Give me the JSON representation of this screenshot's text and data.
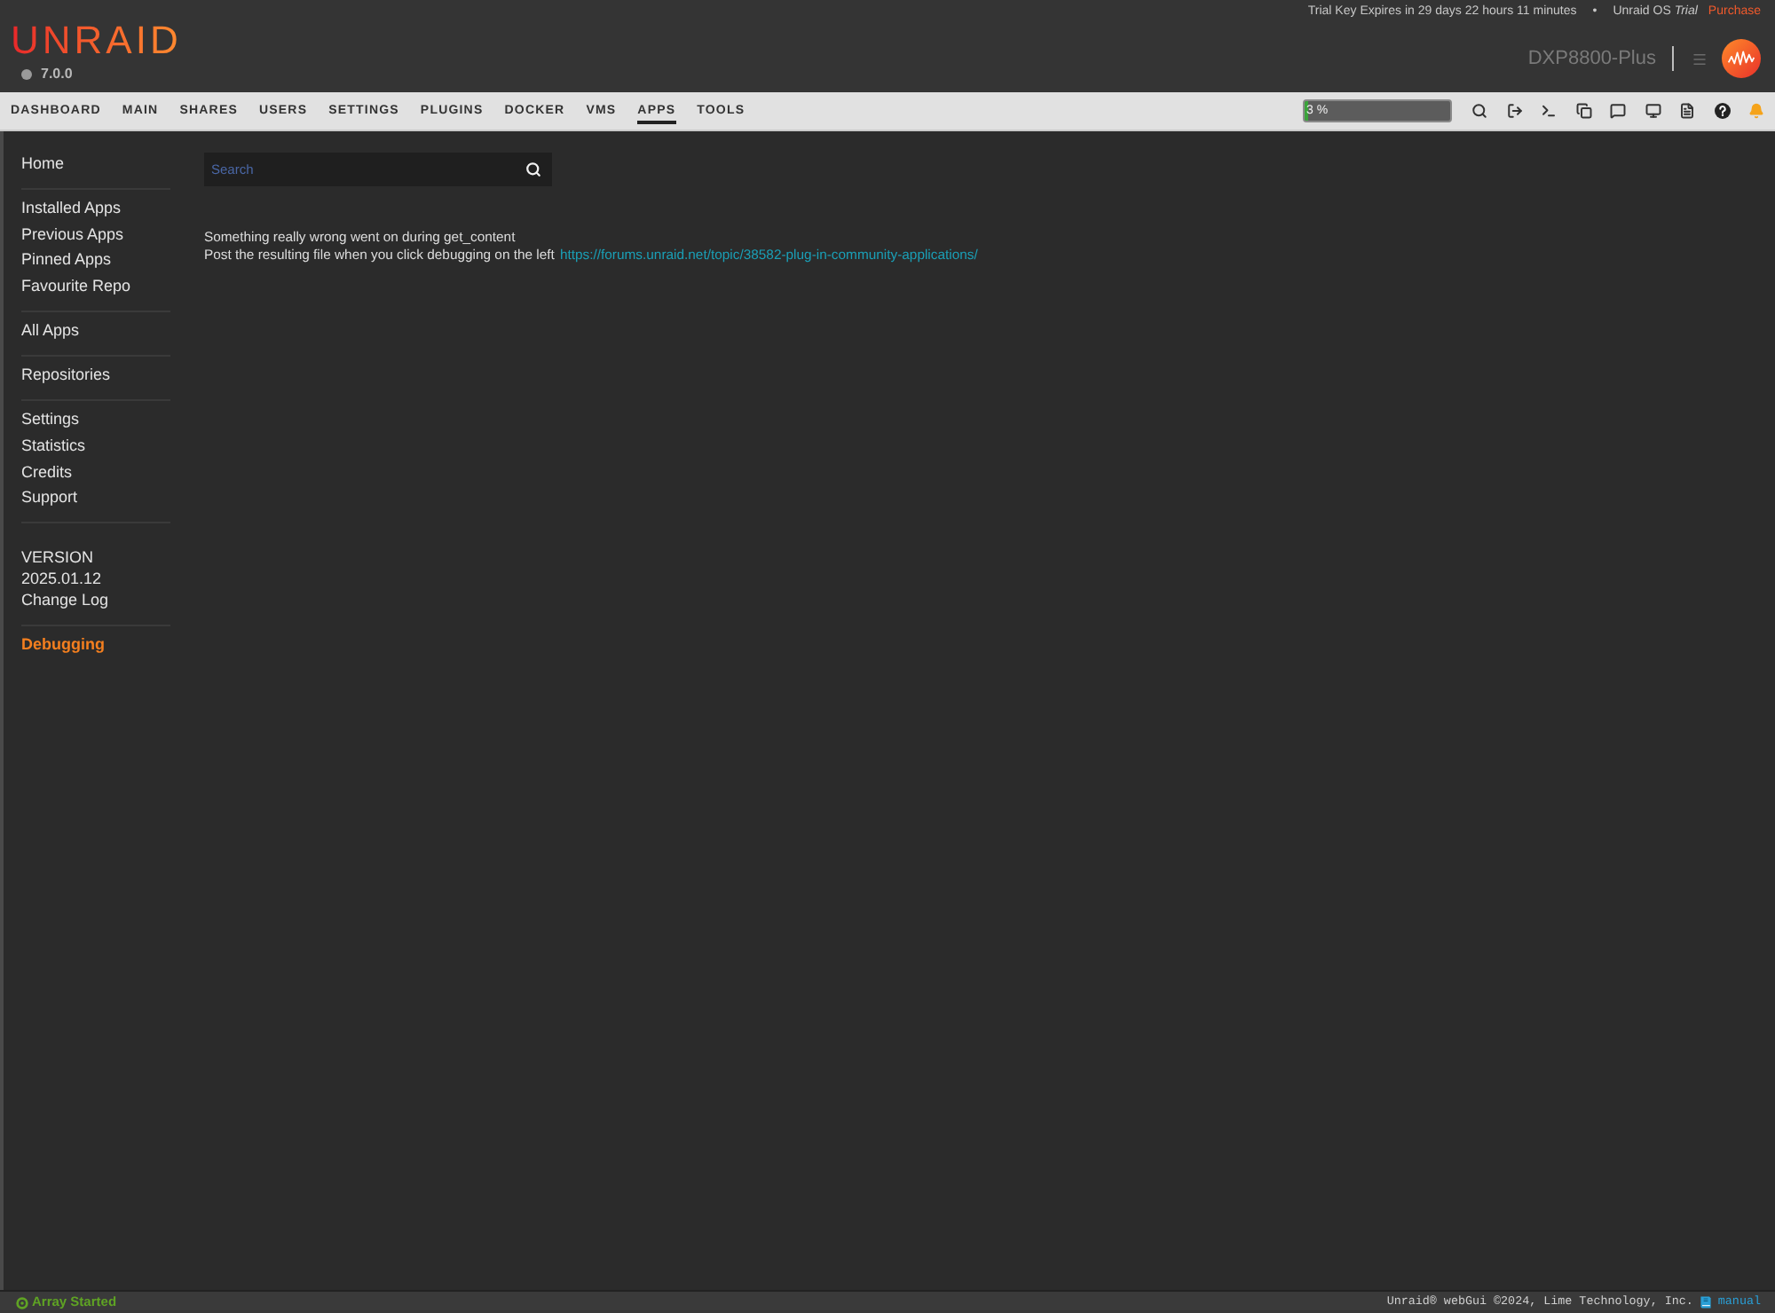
{
  "header": {
    "logo": "UNRAID",
    "version": "7.0.0",
    "trial_notice": {
      "expiry": "Trial Key Expires in 29 days 22 hours 11 minutes",
      "separator": "•",
      "license": "Unraid OS *Trial*",
      "purchase_link": "Purchase"
    },
    "server_name": "DXP8800-Plus"
  },
  "nav": {
    "tabs": [
      {
        "label": "DASHBOARD",
        "selected": false
      },
      {
        "label": "MAIN",
        "selected": false
      },
      {
        "label": "SHARES",
        "selected": false
      },
      {
        "label": "USERS",
        "selected": false
      },
      {
        "label": "SETTINGS",
        "selected": false
      },
      {
        "label": "PLUGINS",
        "selected": false
      },
      {
        "label": "DOCKER",
        "selected": false
      },
      {
        "label": "VMS",
        "selected": false
      },
      {
        "label": "APPS",
        "selected": true
      },
      {
        "label": "TOOLS",
        "selected": false
      }
    ],
    "cpu_meter": {
      "reading": "3 %",
      "level": 0.03
    }
  },
  "sidebar": {
    "groups": [
      {
        "items": [
          "Home"
        ]
      },
      {
        "items": [
          "Installed Apps",
          "Previous Apps",
          "Pinned Apps",
          "Favourite Repo"
        ]
      },
      {
        "items": [
          "All Apps"
        ]
      },
      {
        "items": [
          "Repositories"
        ]
      },
      {
        "items": [
          "Settings",
          "Statistics",
          "Credits",
          "Support"
        ]
      }
    ],
    "version": {
      "label": "VERSION",
      "number": "2025.01.12",
      "changelog_link": "Change Log"
    },
    "debug_link": "Debugging"
  },
  "search": {
    "placeholder": "Search"
  },
  "message": {
    "error": "Something really wrong went on during get_content",
    "instruction": "Post the resulting file when you click debugging on the left",
    "link": "https://forums.unraid.net/topic/38582-plug-in-community-applications/"
  },
  "status_bar": {
    "array_status": "Array Started",
    "copyright": "Unraid® webGui ©2024, Lime Technology, Inc.",
    "manual_link": "manual"
  }
}
